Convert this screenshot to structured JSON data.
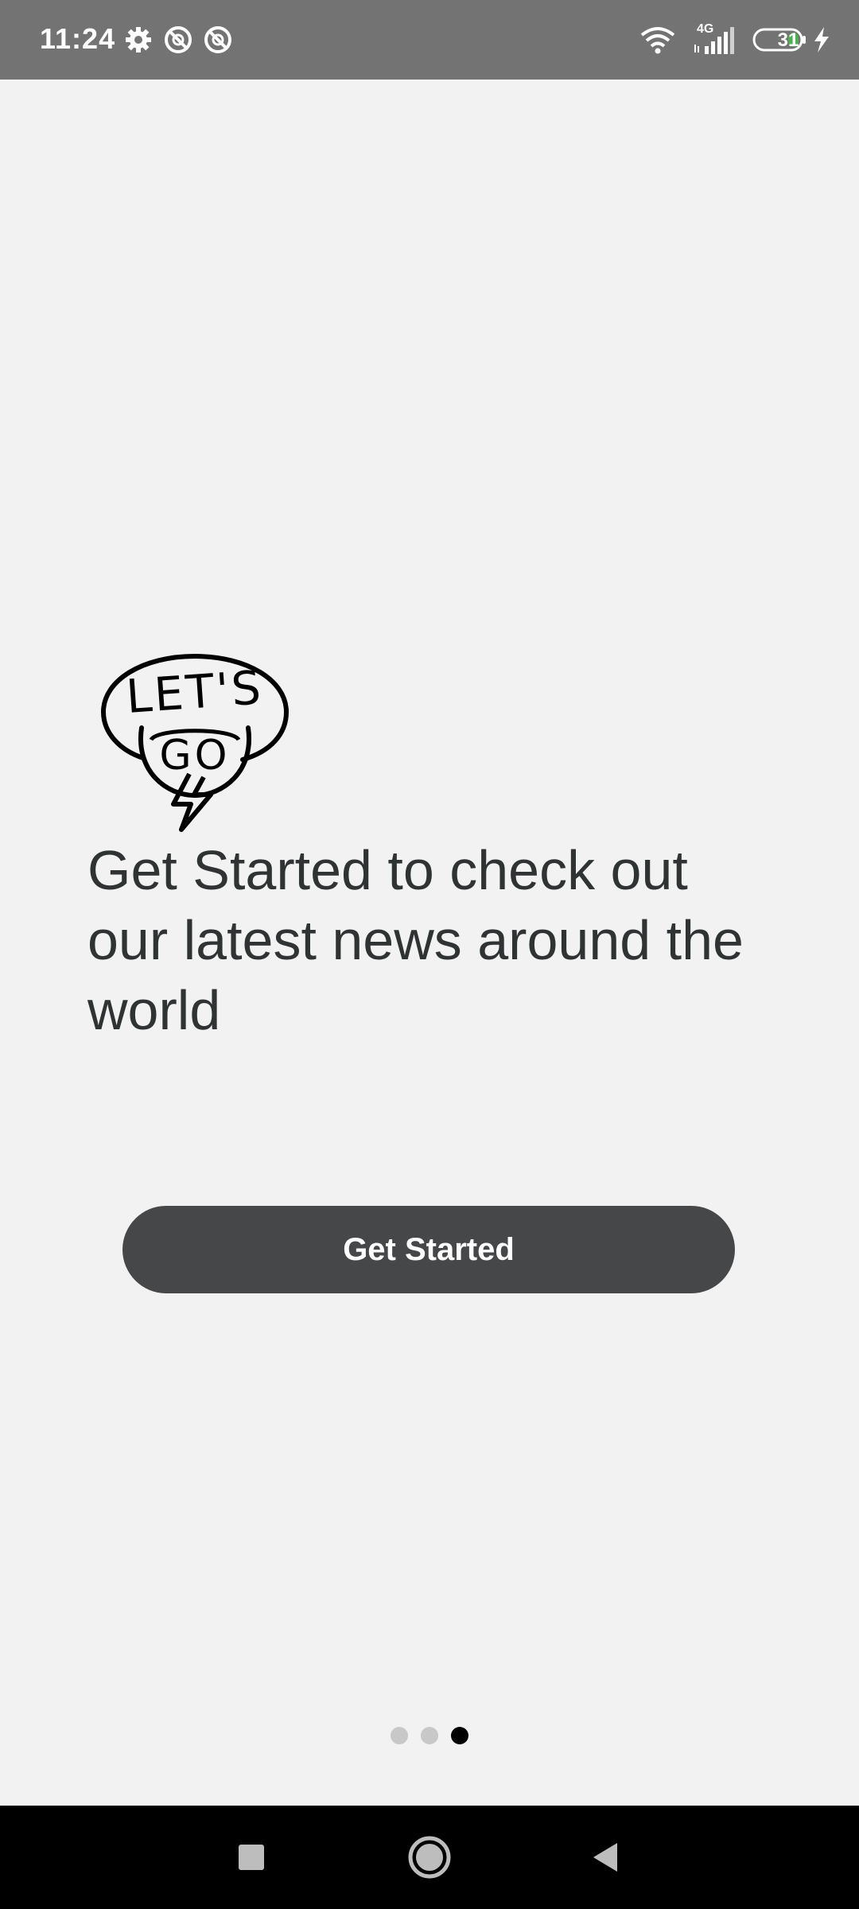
{
  "status_bar": {
    "time": "11:24",
    "network": "4G",
    "battery": "31",
    "icons": [
      "settings-icon",
      "no-disturb-icon",
      "no-disturb-icon",
      "wifi-icon",
      "cellular-signal-icon",
      "battery-icon",
      "charging-icon"
    ]
  },
  "onboarding": {
    "logo_text_top": "LET'S",
    "logo_text_bottom": "GO",
    "headline": "Get Started to check out our latest news around the world",
    "button_label": "Get Started",
    "page_index": 3,
    "page_count": 3
  },
  "nav_bar": {
    "icons": [
      "recent-apps-icon",
      "home-icon",
      "back-icon"
    ]
  },
  "colors": {
    "status_bar": "#737373",
    "background": "#f2f2f2",
    "button": "#464749",
    "text": "#2f3333",
    "dot_inactive": "#c8c8c8",
    "dot_active": "#000000",
    "battery_fill": "#4caf50"
  }
}
